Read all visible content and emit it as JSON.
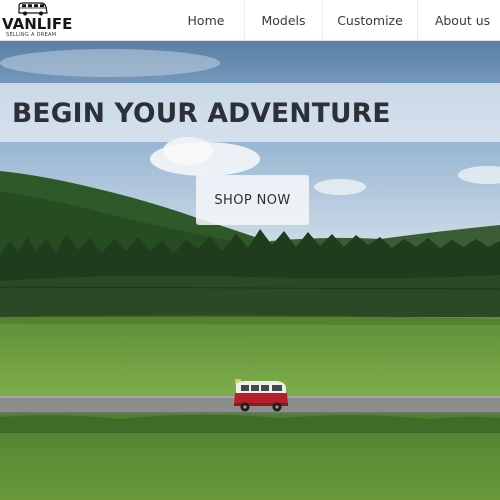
{
  "logo": {
    "title": "VANLIFE",
    "tagline": "SELLING A DREAM"
  },
  "nav": {
    "items": [
      "Home",
      "Models",
      "Customize",
      "About us"
    ]
  },
  "hero": {
    "headline": "BEGIN YOUR ADVENTURE",
    "cta_label": "SHOP NOW"
  },
  "colors": {
    "van_body": "#b3202a",
    "van_roof": "#f2efe6",
    "forest": "#24451f",
    "meadow": "#6d9f3f"
  }
}
